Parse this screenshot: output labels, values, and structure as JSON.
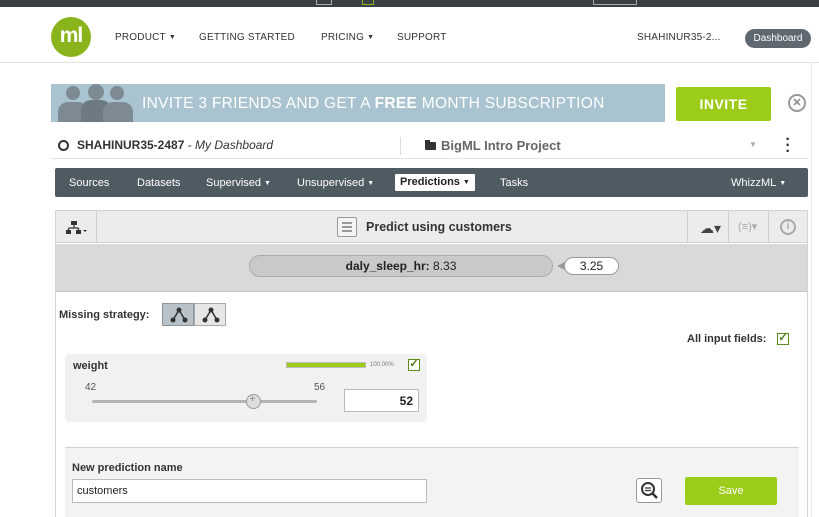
{
  "header": {
    "logo_text": "ml",
    "nav": [
      {
        "label": "PRODUCT",
        "has_caret": true
      },
      {
        "label": "GETTING STARTED",
        "has_caret": false
      },
      {
        "label": "PRICING",
        "has_caret": true
      },
      {
        "label": "SUPPORT",
        "has_caret": false
      }
    ],
    "user_short": "SHAHINUR35-2...",
    "dashboard_button": "Dashboard"
  },
  "banner": {
    "text_prefix": "INVITE 3 FRIENDS AND GET A ",
    "text_bold": "FREE",
    "text_suffix": " MONTH SUBSCRIPTION",
    "invite_button": "INVITE",
    "close_icon": "close-circle-icon"
  },
  "breadcrumb": {
    "user": "SHAHINUR35-2487",
    "separator": " - ",
    "dashboard": "My Dashboard",
    "project": "BigML Intro Project"
  },
  "menubar": {
    "items": [
      {
        "label": "Sources",
        "caret": false
      },
      {
        "label": "Datasets",
        "caret": false
      },
      {
        "label": "Supervised",
        "caret": true
      },
      {
        "label": "Unsupervised",
        "caret": true
      },
      {
        "label": "Predictions",
        "caret": true,
        "active": true
      },
      {
        "label": "Tasks",
        "caret": false
      }
    ],
    "right_item": "WhizzML"
  },
  "panel": {
    "title": "Predict using customers",
    "result_label": "daly_sleep_hr:",
    "result_value": "8.33",
    "confidence": "3.25",
    "missing_strategy_label": "Missing strategy:",
    "all_fields_label": "All input fields:",
    "all_fields_checked": true
  },
  "field": {
    "name": "weight",
    "importance_pct": "100.00%",
    "importance_fraction": 1.0,
    "min": "42",
    "max": "56",
    "slider_value_fraction": 0.714,
    "input_value": "52",
    "checked": true
  },
  "new_prediction": {
    "label": "New prediction name",
    "value": "customers",
    "save_button": "Save"
  },
  "colors": {
    "brand_green": "#9ccc1a",
    "menubar": "#4f5b63",
    "banner": "#a9c3d0"
  }
}
